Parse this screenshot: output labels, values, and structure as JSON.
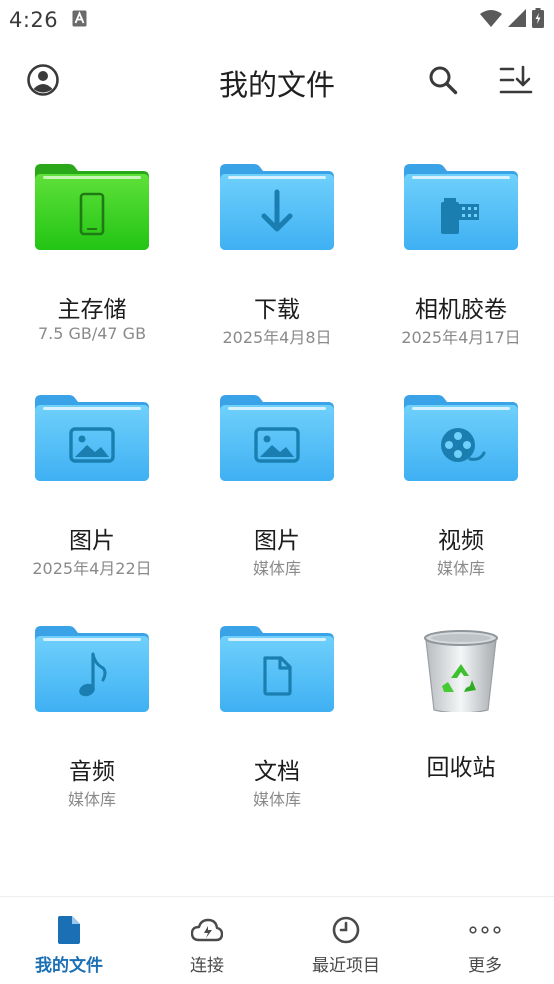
{
  "status_bar": {
    "time": "4:26"
  },
  "header": {
    "title": "我的文件"
  },
  "grid": [
    {
      "name": "主存储",
      "sub": "7.5 GB/47 GB",
      "icon": "phone-folder-icon"
    },
    {
      "name": "下载",
      "sub": "2025年4月8日",
      "icon": "download-folder-icon"
    },
    {
      "name": "相机胶卷",
      "sub": "2025年4月17日",
      "icon": "camera-roll-folder-icon"
    },
    {
      "name": "图片",
      "sub": "2025年4月22日",
      "icon": "image-folder-icon"
    },
    {
      "name": "图片",
      "sub": "媒体库",
      "icon": "image-folder-icon"
    },
    {
      "name": "视频",
      "sub": "媒体库",
      "icon": "video-folder-icon"
    },
    {
      "name": "音频",
      "sub": "媒体库",
      "icon": "music-folder-icon"
    },
    {
      "name": "文档",
      "sub": "媒体库",
      "icon": "document-folder-icon"
    },
    {
      "name": "回收站",
      "sub": "",
      "icon": "recycle-bin-icon"
    }
  ],
  "bottom_nav": [
    {
      "label": "我的文件",
      "icon": "file-icon",
      "active": true
    },
    {
      "label": "连接",
      "icon": "cloud-icon",
      "active": false
    },
    {
      "label": "最近项目",
      "icon": "clock-icon",
      "active": false
    },
    {
      "label": "更多",
      "icon": "more-icon",
      "active": false
    }
  ],
  "colors": {
    "accent": "#1a6fb5",
    "folder_blue": "#4db8f5",
    "folder_green": "#2ecc1a",
    "subtext": "#8a8a8a"
  }
}
